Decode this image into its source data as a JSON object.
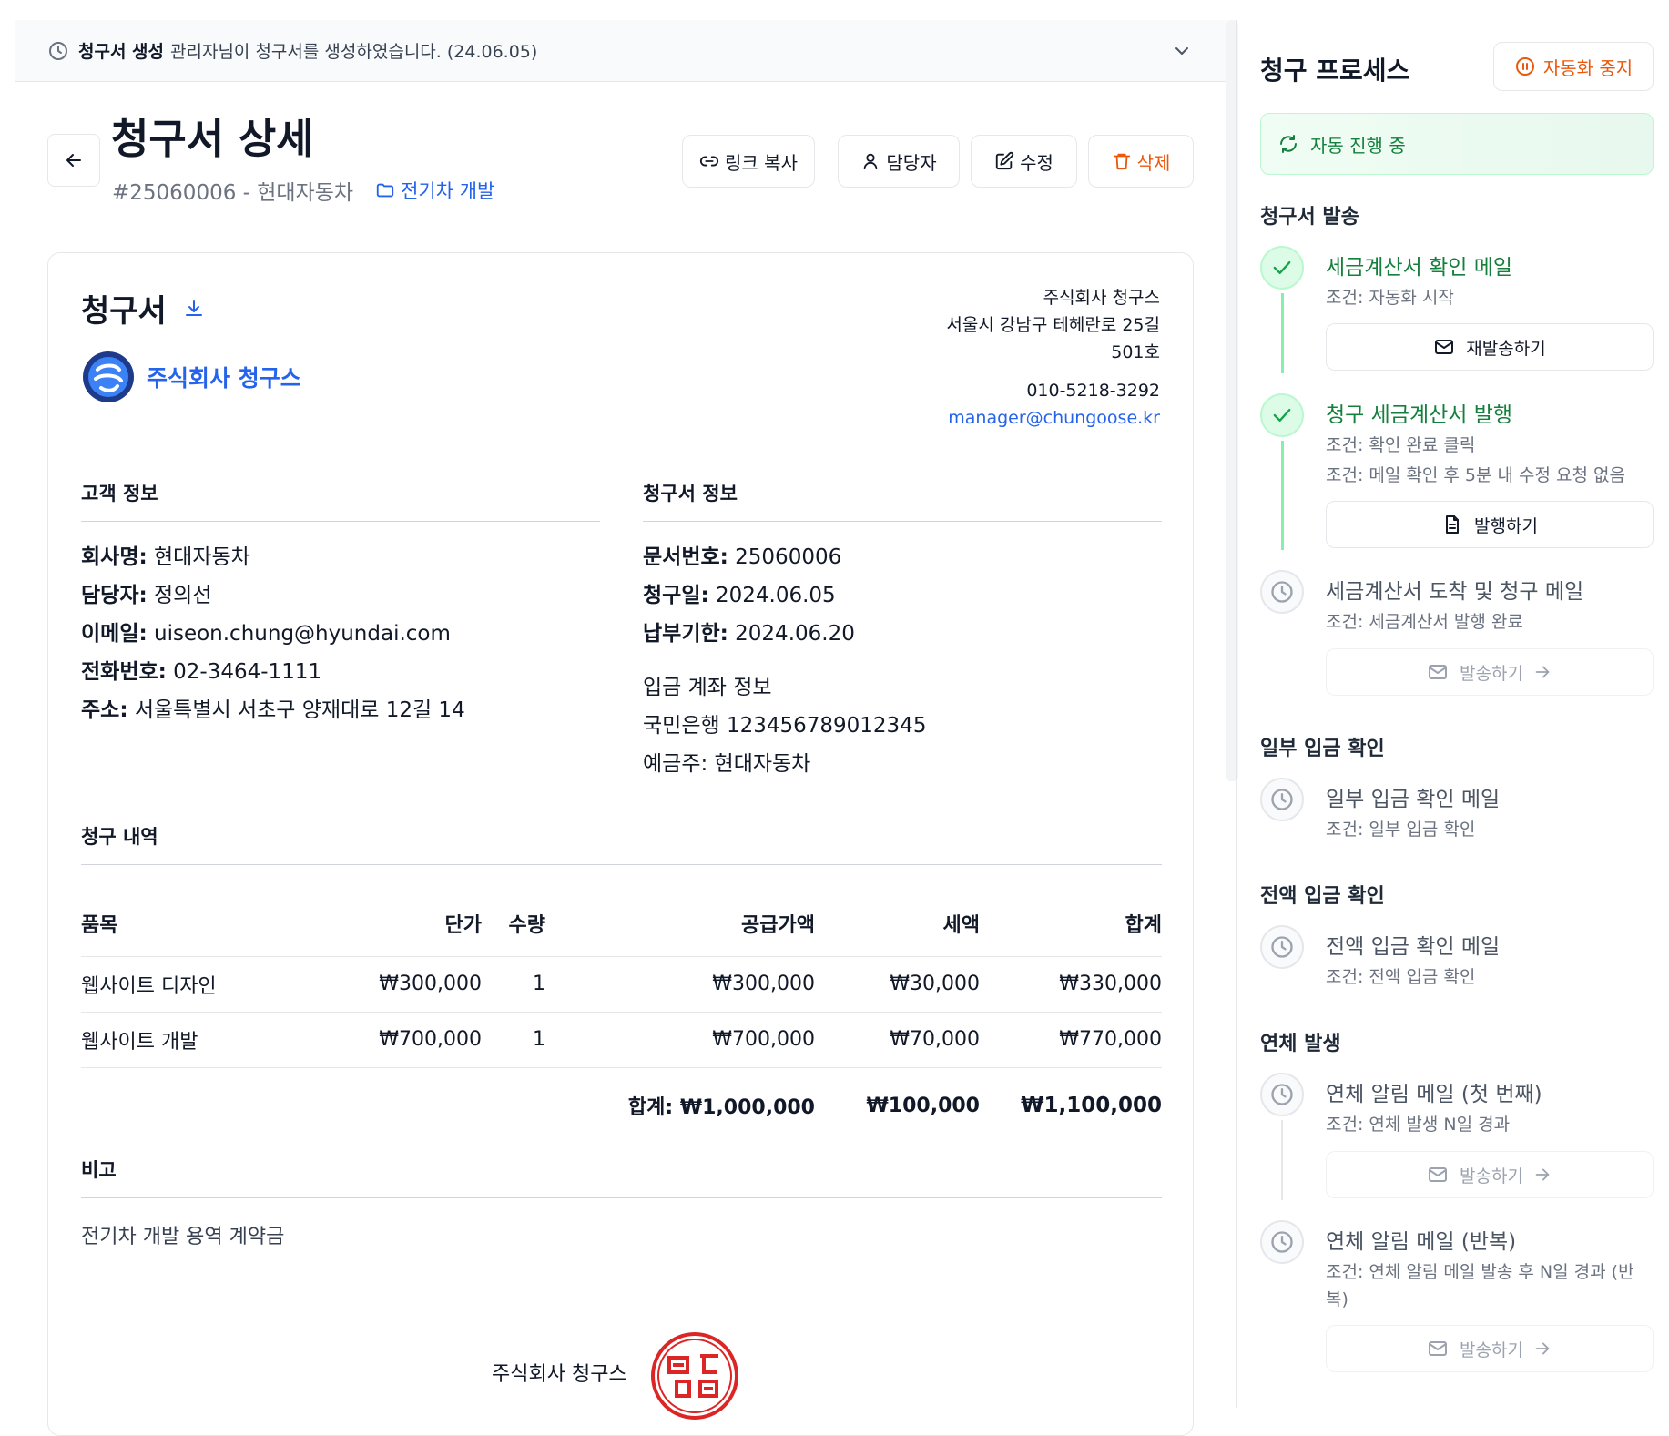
{
  "notice": {
    "title": "청구서 생성",
    "text": "관리자님이 청구서를 생성하였습니다. (24.06.05)"
  },
  "header": {
    "title": "청구서 상세",
    "subtitle": "#25060006 - 현대자동차",
    "project": "전기차 개발",
    "buttons": {
      "copy_link": "링크 복사",
      "assignee": "담당자",
      "edit": "수정",
      "delete": "삭제"
    }
  },
  "invoice": {
    "title": "청구서",
    "logo_name": "주식회사 청구스",
    "company": {
      "name": "주식회사 청구스",
      "address1": "서울시 강남구 테헤란로 25길",
      "address2": "501호",
      "phone": "010-5218-3292",
      "email": "manager@chungoose.kr"
    },
    "customer": {
      "heading": "고객 정보",
      "company_label": "회사명:",
      "company": "현대자동차",
      "contact_label": "담당자:",
      "contact": "정의선",
      "email_label": "이메일:",
      "email": "uiseon.chung@hyundai.com",
      "phone_label": "전화번호:",
      "phone": "02-3464-1111",
      "address_label": "주소:",
      "address": "서울특별시 서초구 양재대로 12길 14"
    },
    "info": {
      "heading": "청구서 정보",
      "doc_label": "문서번호:",
      "doc": "25060006",
      "date_label": "청구일:",
      "date": "2024.06.05",
      "due_label": "납부기한:",
      "due": "2024.06.20",
      "bank_heading": "입금 계좌 정보",
      "bank": "국민은행 123456789012345",
      "holder": "예금주: 현대자동차"
    },
    "items_heading": "청구 내역",
    "columns": {
      "item": "품목",
      "price": "단가",
      "qty": "수량",
      "supply": "공급가액",
      "tax": "세액",
      "total": "합계"
    },
    "rows": [
      {
        "item": "웹사이트 디자인",
        "price": "₩300,000",
        "qty": "1",
        "supply": "₩300,000",
        "tax": "₩30,000",
        "total": "₩330,000"
      },
      {
        "item": "웹사이트 개발",
        "price": "₩700,000",
        "qty": "1",
        "supply": "₩700,000",
        "tax": "₩70,000",
        "total": "₩770,000"
      }
    ],
    "totals": {
      "supply": "합계: ₩1,000,000",
      "tax": "₩100,000",
      "total": "₩1,100,000"
    },
    "note_heading": "비고",
    "note": "전기차 개발 용역 계약금",
    "stamp_company": "주식회사 청구스"
  },
  "process": {
    "title": "청구 프로세스",
    "stop_button": "자동화 중지",
    "status": "자동 진행 중",
    "groups": {
      "send": "청구서 발송",
      "partial": "일부 입금 확인",
      "full": "전액 입금 확인",
      "overdue": "연체 발생"
    },
    "steps": [
      {
        "title": "세금계산서 확인 메일",
        "cond1": "조건: 자동화 시작",
        "button": "재발송하기"
      },
      {
        "title": "청구 세금계산서 발행",
        "cond1": "조건: 확인 완료 클릭",
        "cond2": "조건: 메일 확인 후 5분 내 수정 요청 없음",
        "button": "발행하기"
      },
      {
        "title": "세금계산서 도착 및 청구 메일",
        "cond1": "조건: 세금계산서 발행 완료",
        "button": "발송하기"
      },
      {
        "title": "일부 입금 확인 메일",
        "cond1": "조건: 일부 입금 확인"
      },
      {
        "title": "전액 입금 확인 메일",
        "cond1": "조건: 전액 입금 확인"
      },
      {
        "title": "연체 알림 메일 (첫 번째)",
        "cond1": "조건: 연체 발생 N일 경과",
        "button": "발송하기"
      },
      {
        "title": "연체 알림 메일 (반복)",
        "cond1": "조건: 연체 알림 메일 발송 후 N일 경과 (반복)",
        "button": "발송하기"
      }
    ]
  },
  "colors": {
    "accent": "#2563eb",
    "success": "#16a34a",
    "danger": "#ea580c",
    "stamp": "#dc2626"
  }
}
